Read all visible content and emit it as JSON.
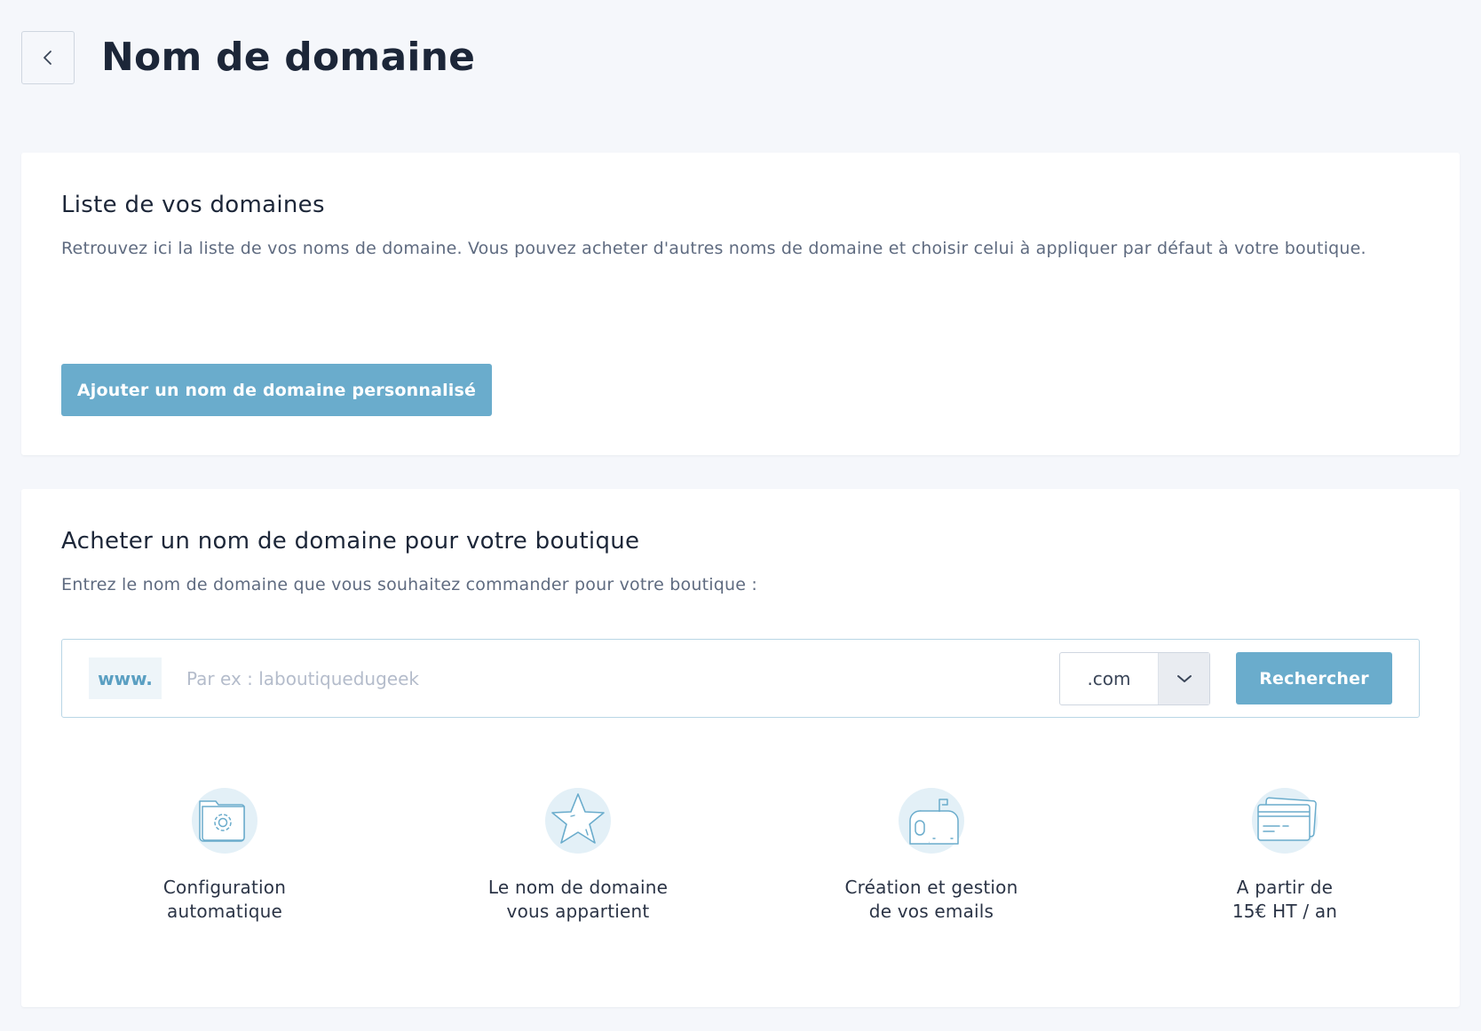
{
  "header": {
    "title": "Nom de domaine",
    "back_icon": "chevron-left-icon"
  },
  "domains_card": {
    "title": "Liste de vos domaines",
    "description": "Retrouvez ici la liste de vos noms de domaine. Vous pouvez acheter d'autres noms de domaine et choisir celui à appliquer par défaut à votre boutique.",
    "add_button_label": "Ajouter un nom de domaine personnalisé"
  },
  "buy_card": {
    "title": "Acheter un nom de domaine pour votre boutique",
    "description": "Entrez le nom de domaine que vous souhaitez commander pour votre boutique :",
    "search": {
      "prefix": "www.",
      "placeholder": "Par ex : laboutiquedugeek",
      "value": "",
      "tld_selected": ".com",
      "button_label": "Rechercher"
    },
    "features": [
      {
        "icon": "folder-gear-icon",
        "label": "Configuration\nautomatique"
      },
      {
        "icon": "star-icon",
        "label": "Le nom de domaine\nvous appartient"
      },
      {
        "icon": "mailbox-icon",
        "label": "Création et gestion\nde vos emails"
      },
      {
        "icon": "credit-card-icon",
        "label": "A partir de\n15€ HT / an"
      }
    ]
  },
  "colors": {
    "background": "#f5f7fb",
    "accent": "#6aaccc",
    "icon_circle": "#e3f0f7",
    "icon_stroke": "#6aaccc"
  }
}
